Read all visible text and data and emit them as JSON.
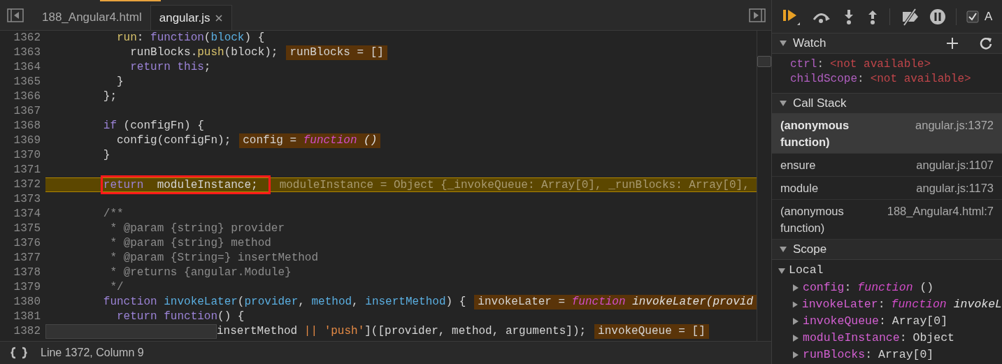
{
  "editor": {
    "tabs": [
      {
        "label": "188_Angular4.html",
        "selected": false,
        "closable": false
      },
      {
        "label": "angular.js",
        "selected": true,
        "closable": true
      }
    ],
    "lines": [
      {
        "number": "1362",
        "current": false,
        "boxed": false,
        "covered": false,
        "tokens": [
          {
            "text": "          run",
            "kind": "property"
          },
          {
            "text": ": ",
            "kind": "plain"
          },
          {
            "text": "function",
            "kind": "keyword"
          },
          {
            "text": "(",
            "kind": "plain"
          },
          {
            "text": "block",
            "kind": "name"
          },
          {
            "text": ") {",
            "kind": "plain"
          }
        ]
      },
      {
        "number": "1363",
        "current": false,
        "boxed": false,
        "covered": false,
        "tokens": [
          {
            "text": "            runBlocks.",
            "kind": "plain"
          },
          {
            "text": "push",
            "kind": "property"
          },
          {
            "text": "(block);",
            "kind": "plain"
          }
        ],
        "inline_value": [
          {
            "text": "runBlocks = []",
            "kind": "plain"
          }
        ]
      },
      {
        "number": "1364",
        "current": false,
        "boxed": false,
        "covered": false,
        "tokens": [
          {
            "text": "            return this",
            "kind": "keyword"
          },
          {
            "text": ";",
            "kind": "plain"
          }
        ]
      },
      {
        "number": "1365",
        "current": false,
        "boxed": false,
        "covered": false,
        "tokens": [
          {
            "text": "          }",
            "kind": "plain"
          }
        ]
      },
      {
        "number": "1366",
        "current": false,
        "boxed": false,
        "covered": false,
        "tokens": [
          {
            "text": "        };",
            "kind": "plain"
          }
        ]
      },
      {
        "number": "1367",
        "current": false,
        "boxed": false,
        "covered": false
      },
      {
        "number": "1368",
        "current": false,
        "boxed": false,
        "covered": false,
        "tokens": [
          {
            "text": "        if",
            "kind": "keyword"
          },
          {
            "text": " (configFn) {",
            "kind": "plain"
          }
        ]
      },
      {
        "number": "1369",
        "current": false,
        "boxed": false,
        "covered": false,
        "tokens": [
          {
            "text": "          config(configFn);",
            "kind": "plain"
          }
        ],
        "inline_value": [
          {
            "text": "config = ",
            "kind": "plain"
          },
          {
            "text": "function",
            "kind": "function"
          },
          {
            "text": " ()",
            "kind": "italic"
          }
        ]
      },
      {
        "number": "1370",
        "current": false,
        "boxed": false,
        "covered": false,
        "tokens": [
          {
            "text": "        }",
            "kind": "plain"
          }
        ]
      },
      {
        "number": "1371",
        "current": false,
        "boxed": false,
        "covered": false
      },
      {
        "number": "1372",
        "current": true,
        "boxed": true,
        "covered": false,
        "tokens": [
          {
            "text": "        return",
            "kind": "keyword"
          },
          {
            "text": "  moduleInstance;",
            "kind": "plain"
          }
        ],
        "inline_value": [
          {
            "text": "moduleInstance = Object {_invokeQueue: Array[0], _runBlocks: Array[0],",
            "kind": "plain"
          }
        ]
      },
      {
        "number": "1373",
        "current": false,
        "boxed": false,
        "covered": false
      },
      {
        "number": "1374",
        "current": false,
        "boxed": false,
        "covered": false,
        "tokens": [
          {
            "text": "        /**",
            "kind": "comment"
          }
        ]
      },
      {
        "number": "1375",
        "current": false,
        "boxed": false,
        "covered": false,
        "tokens": [
          {
            "text": "         * @param {string} provider",
            "kind": "comment"
          }
        ]
      },
      {
        "number": "1376",
        "current": false,
        "boxed": false,
        "covered": false,
        "tokens": [
          {
            "text": "         * @param {string} method",
            "kind": "comment"
          }
        ]
      },
      {
        "number": "1377",
        "current": false,
        "boxed": false,
        "covered": false,
        "tokens": [
          {
            "text": "         * @param {String=} insertMethod",
            "kind": "comment"
          }
        ]
      },
      {
        "number": "1378",
        "current": false,
        "boxed": false,
        "covered": false,
        "tokens": [
          {
            "text": "         * @returns {angular.Module}",
            "kind": "comment"
          }
        ]
      },
      {
        "number": "1379",
        "current": false,
        "boxed": false,
        "covered": false,
        "tokens": [
          {
            "text": "         */",
            "kind": "comment"
          }
        ]
      },
      {
        "number": "1380",
        "current": false,
        "boxed": false,
        "covered": false,
        "tokens": [
          {
            "text": "        function ",
            "kind": "keyword"
          },
          {
            "text": "invokeLater",
            "kind": "name"
          },
          {
            "text": "(",
            "kind": "plain"
          },
          {
            "text": "provider",
            "kind": "name"
          },
          {
            "text": ", ",
            "kind": "plain"
          },
          {
            "text": "method",
            "kind": "name"
          },
          {
            "text": ", ",
            "kind": "plain"
          },
          {
            "text": "insertMethod",
            "kind": "name"
          },
          {
            "text": ") {",
            "kind": "plain"
          }
        ],
        "inline_value": [
          {
            "text": "invokeLater = ",
            "kind": "plain"
          },
          {
            "text": "function",
            "kind": "function"
          },
          {
            "text": " invokeLater(provid",
            "kind": "italic"
          }
        ]
      },
      {
        "number": "1381",
        "current": false,
        "boxed": false,
        "covered": false,
        "tokens": [
          {
            "text": "          return function",
            "kind": "keyword"
          },
          {
            "text": "() {",
            "kind": "plain"
          }
        ]
      },
      {
        "number": "1382",
        "current": false,
        "boxed": false,
        "covered": true,
        "tokens": [
          {
            "text": "insertMethod ",
            "kind": "plain"
          },
          {
            "text": "||",
            "kind": "string"
          },
          {
            "text": " 'push'",
            "kind": "string"
          },
          {
            "text": "]([provider, method, arguments]);",
            "kind": "plain"
          }
        ],
        "inline_value": [
          {
            "text": "invokeQueue = []",
            "kind": "plain"
          }
        ]
      }
    ],
    "status": "Line 1372, Column 9"
  },
  "debugger": {
    "toolbar": [
      {
        "kind": "resume",
        "active": true
      },
      {
        "kind": "step-over",
        "active": false
      },
      {
        "kind": "step-into",
        "active": false
      },
      {
        "kind": "step-out",
        "active": false
      },
      {
        "kind": "deactivate",
        "active": false
      },
      {
        "kind": "pause-exceptions",
        "active": false
      }
    ],
    "async_checkbox": {
      "label": "A",
      "checked": true
    },
    "watch": {
      "title": "Watch",
      "expanded": true,
      "items": [
        {
          "name": "ctrl",
          "separator": ":",
          "value": "<not available>"
        },
        {
          "name": "childScope",
          "separator": ":",
          "value": "<not available>"
        }
      ]
    },
    "call_stack": {
      "title": "Call Stack",
      "expanded": true,
      "frames": [
        {
          "function": "(anonymous function)",
          "location": "angular.js:1372",
          "selected": true
        },
        {
          "function": "ensure",
          "location": "angular.js:1107",
          "selected": false
        },
        {
          "function": "module",
          "location": "angular.js:1173",
          "selected": false
        },
        {
          "function": "(anonymous function)",
          "location": "188_Angular4.html:7",
          "selected": false
        }
      ]
    },
    "scope": {
      "title": "Scope",
      "expanded": true,
      "groups": [
        {
          "label": "Local",
          "expanded": true,
          "children": [
            {
              "name": "config",
              "separator": ":",
              "expanded": false,
              "value": [
                {
                  "text": "function",
                  "kind": "function"
                },
                {
                  "text": " ()",
                  "kind": "plain"
                }
              ]
            },
            {
              "name": "invokeLater",
              "separator": ":",
              "expanded": false,
              "value": [
                {
                  "text": "function",
                  "kind": "function"
                },
                {
                  "text": " invokeL",
                  "kind": "italic"
                }
              ]
            },
            {
              "name": "invokeQueue",
              "separator": ":",
              "expanded": false,
              "value": [
                {
                  "text": "Array[0]",
                  "kind": "plain"
                }
              ]
            },
            {
              "name": "moduleInstance",
              "separator": ":",
              "expanded": false,
              "value": [
                {
                  "text": "Object",
                  "kind": "plain"
                }
              ]
            },
            {
              "name": "runBlocks",
              "separator": ":",
              "expanded": false,
              "value": [
                {
                  "text": "Array[0]",
                  "kind": "plain"
                }
              ]
            }
          ]
        }
      ]
    }
  }
}
